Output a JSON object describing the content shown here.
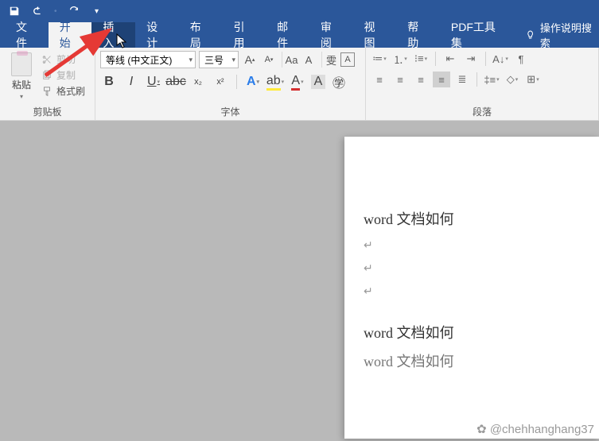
{
  "titlebar": {
    "save": "save",
    "undo": "undo",
    "redo": "redo"
  },
  "tabs": {
    "file": "文件",
    "home": "开始",
    "insert": "插入",
    "design": "设计",
    "layout": "布局",
    "references": "引用",
    "mail": "邮件",
    "review": "审阅",
    "view": "视图",
    "help": "帮助",
    "pdf": "PDF工具集",
    "tellme": "操作说明搜索"
  },
  "clipboard": {
    "paste": "粘贴",
    "cut": "剪切",
    "copy": "复制",
    "formatpainter": "格式刷",
    "group_label": "剪贴板"
  },
  "font": {
    "name": "等线 (中文正文)",
    "size": "三号",
    "group_label": "字体",
    "bold": "B",
    "italic": "I",
    "underline": "U",
    "strike": "abc",
    "sub": "x₂",
    "sup": "x²",
    "grow": "A",
    "shrink": "A",
    "caseAa": "Aa",
    "clear": "A",
    "phonetic": "雯",
    "charborder": "A",
    "highlight": "ab",
    "fontcolor": "A",
    "charshade": "A",
    "circled": "㊫"
  },
  "paragraph": {
    "group_label": "段落"
  },
  "document": {
    "line1": "word 文档如何",
    "line2": "word 文档如何",
    "line3": "word 文档如何"
  },
  "watermark": "✿ @chehhanghang37"
}
